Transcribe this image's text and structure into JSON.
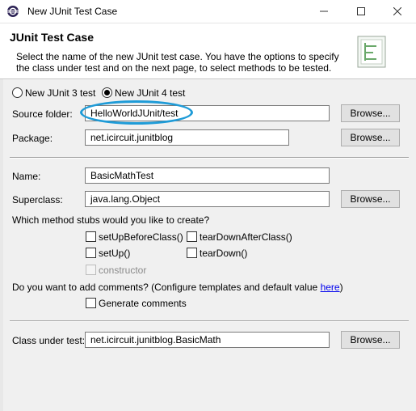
{
  "window": {
    "title": "New JUnit Test Case",
    "minimize_label": "—",
    "maximize_label": "☐",
    "close_label": "✕"
  },
  "header": {
    "title": "JUnit Test Case",
    "description": "Select the name of the new JUnit test case. You have the options to specify the class under test and on the next page, to select methods to be tested."
  },
  "version": {
    "junit3_label": "New JUnit 3 test",
    "junit4_label": "New JUnit 4 test",
    "selected": "junit4"
  },
  "source_folder": {
    "label": "Source folder:",
    "value": "HelloWorldJUnit/test",
    "browse_label": "Browse..."
  },
  "package": {
    "label": "Package:",
    "value": "net.icircuit.junitblog",
    "browse_label": "Browse..."
  },
  "name": {
    "label": "Name:",
    "value": "BasicMathTest"
  },
  "superclass": {
    "label": "Superclass:",
    "value": "java.lang.Object",
    "browse_label": "Browse..."
  },
  "stubs": {
    "question": "Which method stubs would you like to create?",
    "setUpBeforeClass": "setUpBeforeClass()",
    "tearDownAfterClass": "tearDownAfterClass()",
    "setUp": "setUp()",
    "tearDown": "tearDown()",
    "constructor": "constructor"
  },
  "comments": {
    "question_prefix": "Do you want to add comments? (Configure templates and default value ",
    "link_text": "here",
    "question_suffix": ")",
    "generate_label": "Generate comments"
  },
  "class_under_test": {
    "label": "Class under test:",
    "value": "net.icircuit.junitblog.BasicMath",
    "browse_label": "Browse..."
  },
  "colors": {
    "highlight": "#1e9bd7",
    "link": "#0000ee"
  }
}
